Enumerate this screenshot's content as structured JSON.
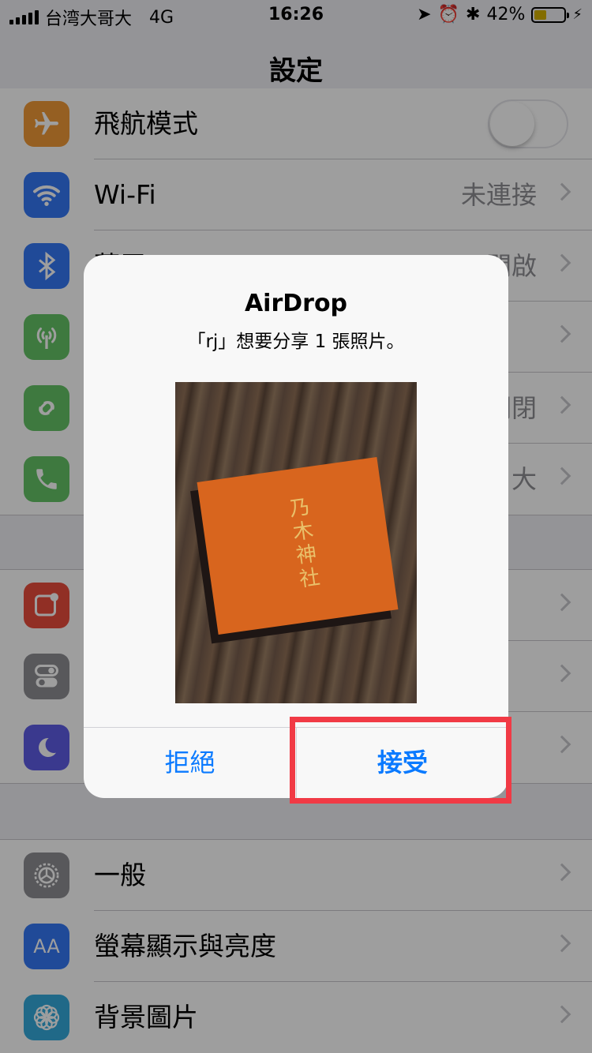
{
  "status_bar": {
    "carrier": "台湾大哥大",
    "network": "4G",
    "time": "16:26",
    "battery_percent_text": "42%",
    "battery_level": 0.42,
    "battery_color": "#d4b000"
  },
  "nav": {
    "title": "設定"
  },
  "groups": [
    {
      "rows": [
        {
          "label": "飛航模式",
          "icon": "airplane-icon",
          "color": "#f09a37",
          "control": "toggle",
          "toggle_on": false
        },
        {
          "label": "Wi-Fi",
          "icon": "wifi-icon",
          "color": "#3478f6",
          "value": "未連接"
        },
        {
          "label": "藍牙",
          "icon": "bluetooth-icon",
          "color": "#3478f6",
          "value": "開啟"
        },
        {
          "label": "",
          "icon": "cellular-icon",
          "color": "#65c466",
          "value": ""
        },
        {
          "label": "",
          "icon": "hotspot-icon",
          "color": "#65c466",
          "value": "關閉"
        },
        {
          "label": "",
          "icon": "phone-icon",
          "color": "#65c466",
          "value": "大"
        }
      ]
    },
    {
      "rows": [
        {
          "label": "",
          "icon": "notifications-icon",
          "color": "#eb4d3d"
        },
        {
          "label": "",
          "icon": "control-center-icon",
          "color": "#8e8e93"
        },
        {
          "label": "",
          "icon": "do-not-disturb-icon",
          "color": "#5e5ce6"
        }
      ]
    },
    {
      "rows": [
        {
          "label": "一般",
          "icon": "gear-icon",
          "color": "#8e8e93"
        },
        {
          "label": "螢幕顯示與亮度",
          "icon": "display-brightness-icon",
          "color": "#3478f6"
        },
        {
          "label": "背景圖片",
          "icon": "wallpaper-icon",
          "color": "#35aadc"
        }
      ]
    }
  ],
  "alert": {
    "title": "AirDrop",
    "message": "「rj」想要分享 1 張照片。",
    "photo_caption": "乃木神社",
    "decline_label": "拒絕",
    "accept_label": "接受",
    "button_color": "#0a7aff"
  },
  "highlight_color": "#f13a45"
}
